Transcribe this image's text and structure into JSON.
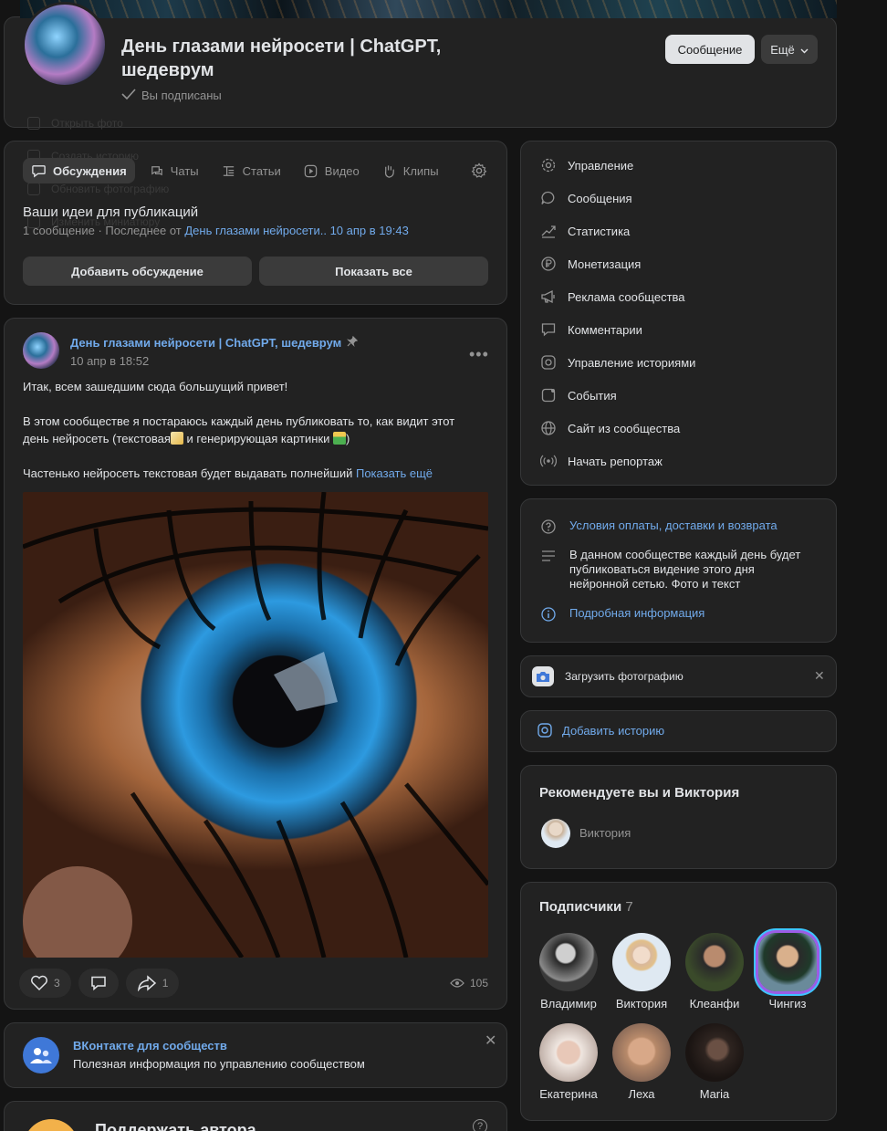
{
  "header": {
    "title": "День глазами нейросети | ChatGPT, шедеврум",
    "subscribed": "Вы подписаны",
    "message_button": "Сообщение",
    "more_button": "Ещё",
    "ghost_menu": [
      "Открыть фото",
      "Создать историю",
      "Обновить фотографию",
      "Изменить миниатюру"
    ]
  },
  "tabs": [
    {
      "label": "Обсуждения",
      "icon": "discussion-icon",
      "active": true
    },
    {
      "label": "Чаты",
      "icon": "chats-icon"
    },
    {
      "label": "Статьи",
      "icon": "articles-icon"
    },
    {
      "label": "Видео",
      "icon": "video-icon"
    },
    {
      "label": "Клипы",
      "icon": "clips-icon"
    }
  ],
  "discussions": {
    "topic_title": "Ваши идеи для публикаций",
    "meta_prefix": "1 сообщение · Последнее от ",
    "meta_link": "День глазами нейросети.. 10 апр в 19:43",
    "add_button": "Добавить обсуждение",
    "show_all_button": "Показать все"
  },
  "post": {
    "author": "День глазами нейросети | ChatGPT, шедеврум",
    "date": "10 апр в 18:52",
    "line1": "Итак, всем зашедшим сюда большущий привет!",
    "line2": "В этом сообществе я постараюсь каждый день публиковать то, как видит этот",
    "line3a": "день нейросеть (текстовая",
    "line3b": " и генерирующая картинки",
    "line3c": ")",
    "line4": "Частенько нейросеть текстовая будет выдавать полнейший",
    "show_more": "Показать ещё",
    "likes": "3",
    "shares": "1",
    "views": "105"
  },
  "vk_promo": {
    "title": "ВКонтакте для сообществ",
    "subtitle": "Полезная информация по управлению сообществом"
  },
  "support": {
    "title": "Поддержать автора"
  },
  "menu": [
    {
      "label": "Управление",
      "icon": "gear-icon"
    },
    {
      "label": "Сообщения",
      "icon": "message-icon"
    },
    {
      "label": "Статистика",
      "icon": "stats-icon"
    },
    {
      "label": "Монетизация",
      "icon": "ruble-icon"
    },
    {
      "label": "Реклама сообщества",
      "icon": "megaphone-icon"
    },
    {
      "label": "Комментарии",
      "icon": "comment-icon"
    },
    {
      "label": "Управление историями",
      "icon": "stories-icon"
    },
    {
      "label": "События",
      "icon": "events-icon"
    },
    {
      "label": "Сайт из сообщества",
      "icon": "globe-icon"
    },
    {
      "label": "Начать репортаж",
      "icon": "broadcast-icon"
    }
  ],
  "info": {
    "payment_terms": "Условия оплаты, доставки и возврата",
    "description": "В данном сообществе каждый день будет публиковаться видение этого дня нейронной сетью. Фото и текст",
    "more_info": "Подробная информация"
  },
  "upload_photo": "Загрузить фотографию",
  "add_story": "Добавить историю",
  "recommend": {
    "title": "Рекомендуете вы и Виктория",
    "name": "Виктория"
  },
  "subscribers": {
    "title": "Подписчики",
    "count": "7",
    "people": [
      {
        "name": "Владимир",
        "color": "#3a3a3a"
      },
      {
        "name": "Виктория",
        "color": "#dfe9f2"
      },
      {
        "name": "Клеанфи",
        "color": "#2f3a2a"
      },
      {
        "name": "Чингиз",
        "color": "#4a5a6a"
      },
      {
        "name": "Екатерина",
        "color": "#d8c4b8"
      },
      {
        "name": "Леха",
        "color": "#b8a090"
      },
      {
        "name": "Maria",
        "color": "#3a2e28"
      }
    ]
  },
  "colors": {
    "bg": "#141414",
    "card": "#222222",
    "accent": "#71aaeb",
    "text": "#e1e3e6",
    "muted": "#939393"
  }
}
